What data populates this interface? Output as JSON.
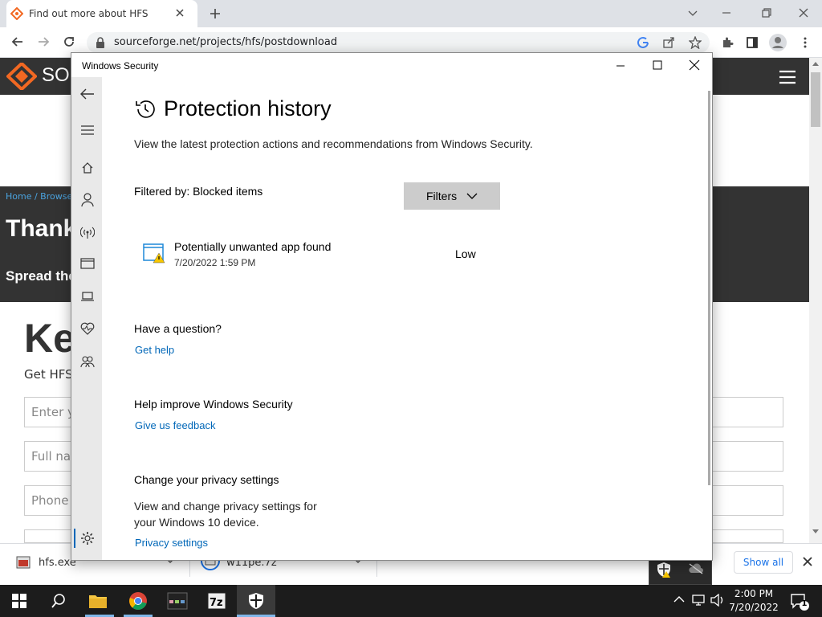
{
  "browser": {
    "tab_title": "Find out more about HFS ~ HTTP",
    "url": "sourceforge.net/projects/hfs/postdownload"
  },
  "page": {
    "logo_text": "SO",
    "breadcrumb": "Home / Browse",
    "heading": "Thank",
    "spread": "Spread the",
    "big_heading": "Ke",
    "get_text": "Get HFS",
    "fields": [
      "Enter y",
      "Full nar",
      "Phone"
    ]
  },
  "downloads": {
    "items": [
      {
        "name": "hfs.exe"
      },
      {
        "name": "w11pe.7z"
      }
    ],
    "show_all": "Show all"
  },
  "taskbar": {
    "time": "2:00 PM",
    "date": "7/20/2022",
    "notification_count": "1"
  },
  "security": {
    "window_title": "Windows Security",
    "title": "Protection history",
    "description": "View the latest protection actions and recommendations from Windows Security.",
    "filtered_by": "Filtered by: Blocked items",
    "filters_label": "Filters",
    "item": {
      "title": "Potentially unwanted app found",
      "date": "7/20/2022 1:59 PM",
      "severity": "Low"
    },
    "question_heading": "Have a question?",
    "get_help": "Get help",
    "improve_heading": "Help improve Windows Security",
    "feedback": "Give us feedback",
    "privacy_heading": "Change your privacy settings",
    "privacy_desc": "View and change privacy settings for your Windows 10 device.",
    "privacy_link": "Privacy settings"
  },
  "colors": {
    "accent": "#0067b8",
    "sf_orange": "#f26822"
  }
}
